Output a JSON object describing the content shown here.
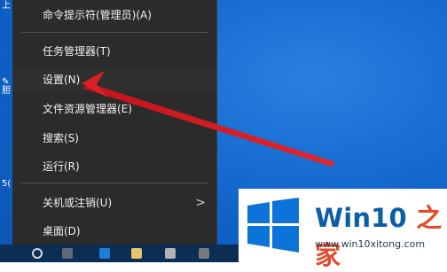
{
  "menu": {
    "items": [
      {
        "label": "命令提示符(管理员)(A)"
      },
      {
        "label": "任务管理器(T)"
      },
      {
        "label": "设置(N)"
      },
      {
        "label": "文件资源管理器(E)"
      },
      {
        "label": "搜索(S)"
      },
      {
        "label": "运行(R)"
      },
      {
        "label": "关机或注销(U)"
      },
      {
        "label": "桌面(D)"
      }
    ],
    "submenu_glyph": ">"
  },
  "brand": {
    "name_main": "Win10",
    "name_accent": " 之家",
    "url": "www.win10xitong.com"
  },
  "colors": {
    "menu_bg": "#2b2b2b",
    "desktop_blue": "#0f63c9",
    "arrow_red": "#d92027",
    "brand_blue": "#0c5ea8"
  },
  "icons": [
    "windows-logo-icon",
    "chevron-right-icon",
    "taskbar-icons"
  ]
}
